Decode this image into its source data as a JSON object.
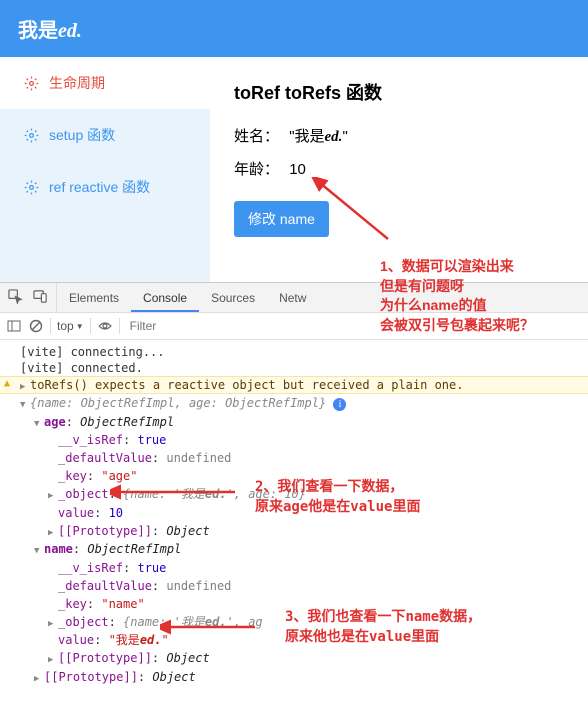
{
  "header": {
    "title_prefix": "我是",
    "title_ed": "ed."
  },
  "sidebar": {
    "items": [
      {
        "label": "生命周期"
      },
      {
        "label": "setup 函数"
      },
      {
        "label": "ref reactive 函数"
      }
    ]
  },
  "content": {
    "heading": "toRef toRefs 函数",
    "name_label": "姓名：",
    "name_value_prefix": "\"我是",
    "name_value_ed": "ed.",
    "name_value_suffix": "\"",
    "age_label": "年龄：",
    "age_value": "10",
    "button": "修改 name"
  },
  "annotations": {
    "a1_l1": "1、数据可以渲染出来",
    "a1_l2": "但是有问题呀",
    "a1_l3_pre": "为什么",
    "a1_l3_bold": "name",
    "a1_l3_post": "的值",
    "a1_l4": "会被双引号包裹起来呢？",
    "a2_l1": "2、我们查看一下数据，",
    "a2_l2_pre": "原来age他是在",
    "a2_l2_bold": "value",
    "a2_l2_post": "里面",
    "a3_l1_pre": "3、我们也查看一下",
    "a3_l1_bold": "name",
    "a3_l1_post": "数据，",
    "a3_l2_pre": "原来他也是在",
    "a3_l2_bold": "value",
    "a3_l2_post": "里面"
  },
  "devtools": {
    "tabs": [
      "Elements",
      "Console",
      "Sources",
      "Netw"
    ],
    "active_tab": 1,
    "top": "top",
    "filter_placeholder": "Filter"
  },
  "console": {
    "l1": "[vite] connecting...",
    "l2": "[vite] connected.",
    "warn": "toRefs() expects a reactive object but received a plain one.",
    "root_preview": "{name: ObjectRefImpl, age: ObjectRefImpl}",
    "age_k": "age",
    "age_v": "ObjectRefImpl",
    "isRef_k": "__v_isRef",
    "isRef_v": "true",
    "defVal_k": "_defaultValue",
    "defVal_v": "undefined",
    "key_k": "_key",
    "key_age": "\"age\"",
    "key_name": "\"name\"",
    "obj_k": "_object",
    "obj_preview_pre": "{name: '",
    "obj_preview_name": "我是",
    "obj_preview_ed": "ed.",
    "obj_preview_post_age": "', age: 10}",
    "obj_preview_post_name": "', ag",
    "value_k": "value",
    "value_age": "10",
    "value_name_pre": "\"我是",
    "value_name_ed": "ed.",
    "value_name_post": "\"",
    "proto_k": "[[Prototype]]",
    "proto_v": "Object",
    "name_k": "name",
    "name_v": "ObjectRefImpl"
  }
}
